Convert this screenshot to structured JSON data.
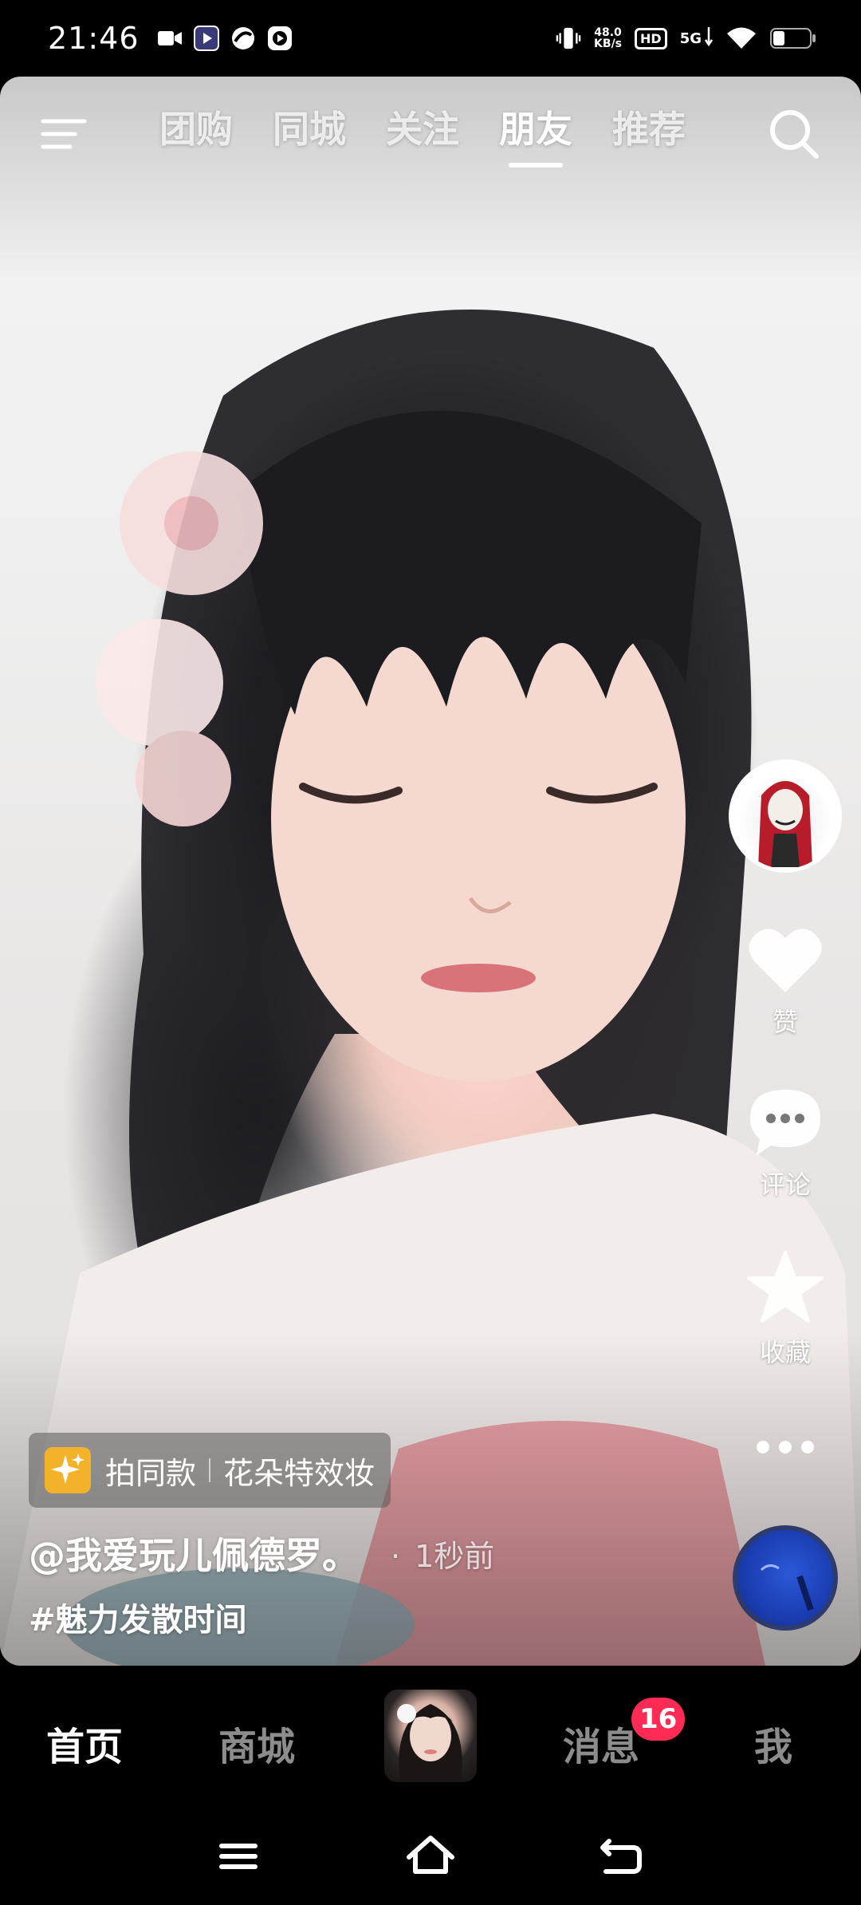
{
  "status_bar": {
    "time": "21:46",
    "net_speed_value": "48.0",
    "net_speed_unit": "KB/s",
    "hd": "HD",
    "network": "5G"
  },
  "top_nav": {
    "tabs": [
      {
        "label": "团购"
      },
      {
        "label": "同城"
      },
      {
        "label": "关注"
      },
      {
        "label": "朋友"
      },
      {
        "label": "推荐"
      }
    ],
    "active_tab": "朋友"
  },
  "actions": {
    "like_label": "赞",
    "comment_label": "评论",
    "favorite_label": "收藏"
  },
  "video_info": {
    "effect_action": "拍同款",
    "effect_name": "花朵特效妆",
    "author": "@我爱玩儿佩德罗。",
    "time_ago": "1秒前",
    "hashtag": "#魅力发散时间"
  },
  "tabbar": {
    "home": "首页",
    "mall": "商城",
    "messages": "消息",
    "messages_badge": "16",
    "me": "我"
  },
  "colors": {
    "badge": "#fe2c55",
    "effect_icon": "#f3b22a"
  }
}
